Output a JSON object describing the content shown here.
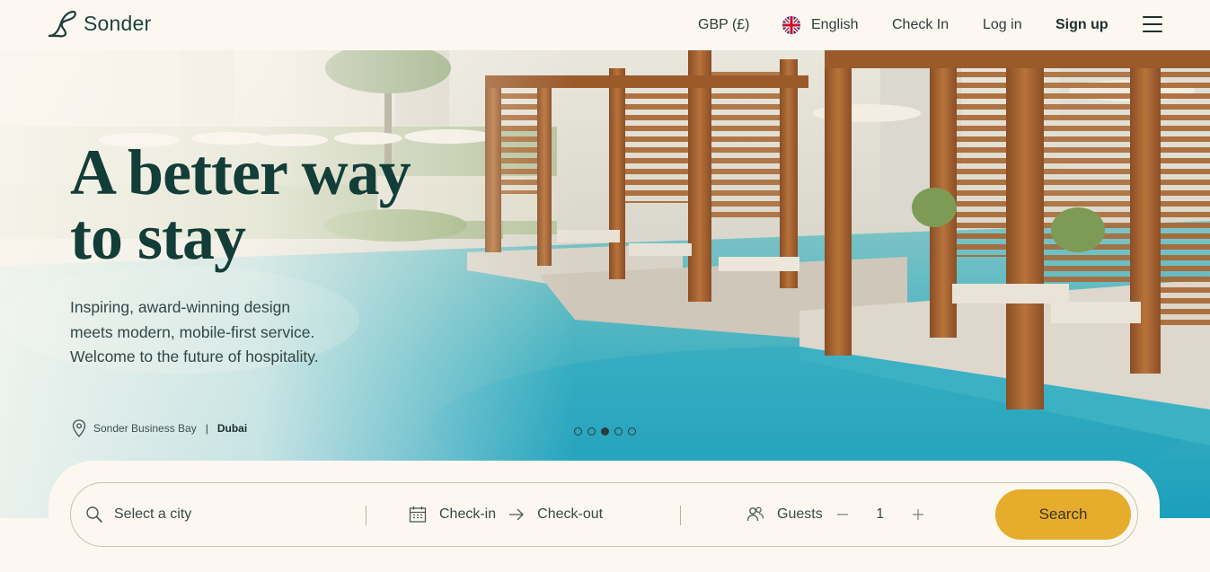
{
  "brand": {
    "name": "Sonder"
  },
  "nav": {
    "currency": "GBP (£)",
    "language": "English",
    "check_in": "Check In",
    "log_in": "Log in",
    "sign_up": "Sign up"
  },
  "hero": {
    "headline_line1": "A better way",
    "headline_line2": "to stay",
    "subline_1": "Inspiring, award-winning design",
    "subline_2": "meets modern, mobile-first service.",
    "subline_3": "Welcome to the future of hospitality.",
    "location_name": "Sonder Business Bay",
    "location_separator": "|",
    "location_city": "Dubai",
    "carousel": {
      "total": 5,
      "active_index": 2
    }
  },
  "search": {
    "city_placeholder": "Select a city",
    "check_in": "Check-in",
    "check_out": "Check-out",
    "guests_label": "Guests",
    "guests_value": "1",
    "button": "Search"
  },
  "colors": {
    "accent": "#e5ad2b",
    "brand_dark": "#123d38",
    "background": "#fcf8f1"
  }
}
